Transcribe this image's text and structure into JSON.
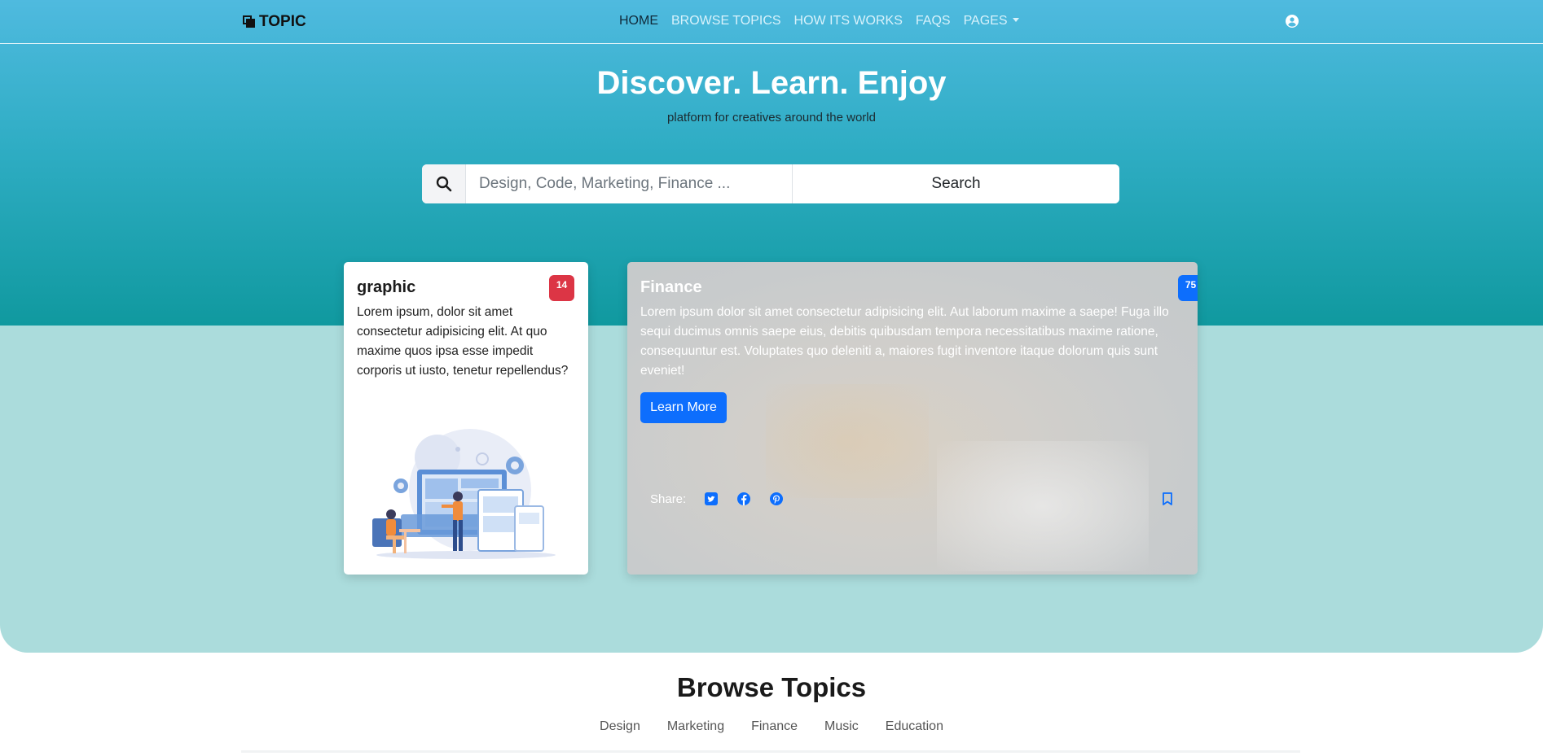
{
  "brand": {
    "name": "TOPIC"
  },
  "nav": {
    "items": [
      {
        "label": "HOME"
      },
      {
        "label": "BROWSE TOPICS"
      },
      {
        "label": "HOW ITS WORKS"
      },
      {
        "label": "FAQS"
      },
      {
        "label": "PAGES"
      }
    ]
  },
  "hero": {
    "title": "Discover. Learn. Enjoy",
    "subtitle": "platform for creatives around the world"
  },
  "search": {
    "placeholder": "Design, Code, Marketing, Finance ...",
    "button_label": "Search"
  },
  "cards": {
    "graphic": {
      "title": "graphic",
      "badge": "14",
      "text": "Lorem ipsum, dolor sit amet consectetur adipisicing elit. At quo maxime quos ipsa esse impedit corporis ut iusto, tenetur repellendus?"
    },
    "finance": {
      "title": "Finance",
      "badge": "75",
      "text": "Lorem ipsum dolor sit amet consectetur adipisicing elit. Aut laborum maxime a saepe! Fuga illo sequi ducimus omnis saepe eius, debitis quibusdam tempora necessitatibus maxime ratione, consequuntur est. Voluptates quo deleniti a, maiores fugit inventore itaque dolorum quis sunt eveniet!",
      "button_label": "Learn More",
      "share_label": "Share:"
    }
  },
  "browse": {
    "title": "Browse Topics",
    "tabs": [
      {
        "label": "Design"
      },
      {
        "label": "Marketing"
      },
      {
        "label": "Finance"
      },
      {
        "label": "Music"
      },
      {
        "label": "Education"
      }
    ]
  },
  "colors": {
    "accent": "#0d6efd",
    "badge_red": "#dc3545",
    "hero_top": "#4fbadf",
    "hero_bottom": "#10999f",
    "band": "#abdcdc"
  },
  "icons": [
    "brand-icon",
    "user-icon",
    "search-icon",
    "twitter-icon",
    "facebook-icon",
    "pinterest-icon",
    "bookmark-icon"
  ]
}
